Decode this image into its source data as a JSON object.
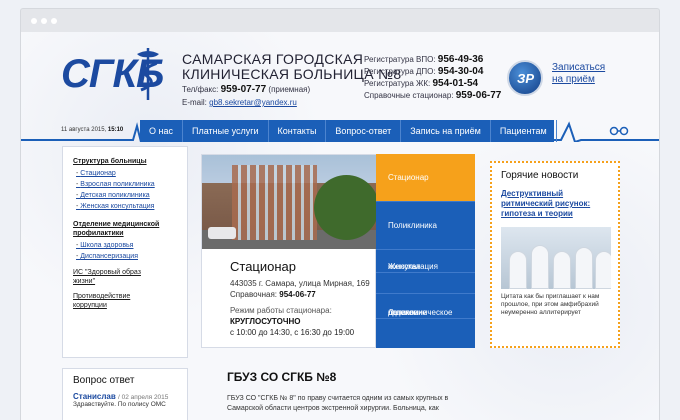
{
  "header": {
    "logo_text": "СГКБ",
    "org_name_line1": "САМАРСКАЯ ГОРОДСКАЯ",
    "org_name_line2": "КЛИНИЧЕСКАЯ БОЛЬНИЦА №8",
    "tel_label": "Тел/факс:",
    "tel_value": "959-07-77",
    "tel_note": "(приемная)",
    "email_label": "E-mail:",
    "email_value": "gb8.sekretar@yandex.ru",
    "phones": [
      {
        "label": "Регистратура ВПО:",
        "value": "956-49-36"
      },
      {
        "label": "Регистратура ДПО:",
        "value": "954-30-04"
      },
      {
        "label": "Регистратура ЖК:",
        "value": "954-01-54"
      },
      {
        "label": "Справочные стационар:",
        "value": "959-06-77"
      }
    ],
    "badge_text": "ЗР",
    "signup_line1": "Записаться",
    "signup_line2": "на приём"
  },
  "datetime": {
    "date": "11 августа 2015,",
    "time": "15:10"
  },
  "nav": [
    "О нас",
    "Платные услуги",
    "Контакты",
    "Вопрос-ответ",
    "Запись на приём",
    "Пациентам"
  ],
  "sidebar": {
    "sec1": "Структура больницы",
    "sec1_items": [
      "Стационар",
      "Взрослая поликлиника",
      "Детская поликлиника",
      "Женская консультация"
    ],
    "sec2_line1": "Отделение медицинской",
    "sec2_line2": "профилактики",
    "sec2_items": [
      "Школа здоровья",
      "Диспансеризация"
    ],
    "link3_line1": "ИС \"Здоровый образ",
    "link3_line2": "жизни\"",
    "link4_line1": "Противодействие",
    "link4_line2": "коррупции"
  },
  "feature": {
    "title": "Стационар",
    "address": "443035 г. Самара, улица Мирная, 169",
    "ref_label": "Справочная:",
    "ref_value": "954-06-77",
    "hours_label": "Режим работы стационара:",
    "hours_value": "КРУГЛОСУТОЧНО",
    "visit": "с 10:00 до 14:30, с 16:30 до 19:00"
  },
  "tabs": [
    {
      "lines": [
        "Стационар"
      ]
    },
    {
      "lines": [
        "Поликлиника"
      ]
    },
    {
      "lines": [
        "Женская",
        "консультация"
      ]
    },
    {
      "lines": [
        "Детское",
        "поликлиническое",
        "отделение"
      ]
    }
  ],
  "news": {
    "heading": "Горячие новости",
    "link_lines": [
      "Деструктивный",
      "ритмический рисунок:",
      "гипотеза и теории"
    ],
    "text_lines": [
      "Цитата как бы приглашает к нам",
      "прошлое, при этом амфибрахий",
      "неумеренно аллитерирует"
    ]
  },
  "qa": {
    "heading": "Вопрос ответ",
    "name": "Станислав",
    "date": "/ 02 апреля 2015",
    "text": "Здравствуйте. По полису ОМС"
  },
  "about": {
    "title": "ГБУЗ СО СГКБ №8",
    "line1": "ГБУЗ СО \"СГКБ № 8\" по праву считается одним из самых крупных в",
    "line2": "Самарской области центров экстренной хирургии. Больница, как"
  },
  "colors": {
    "brand": "#1b5fb8",
    "accent": "#f6a11b"
  }
}
